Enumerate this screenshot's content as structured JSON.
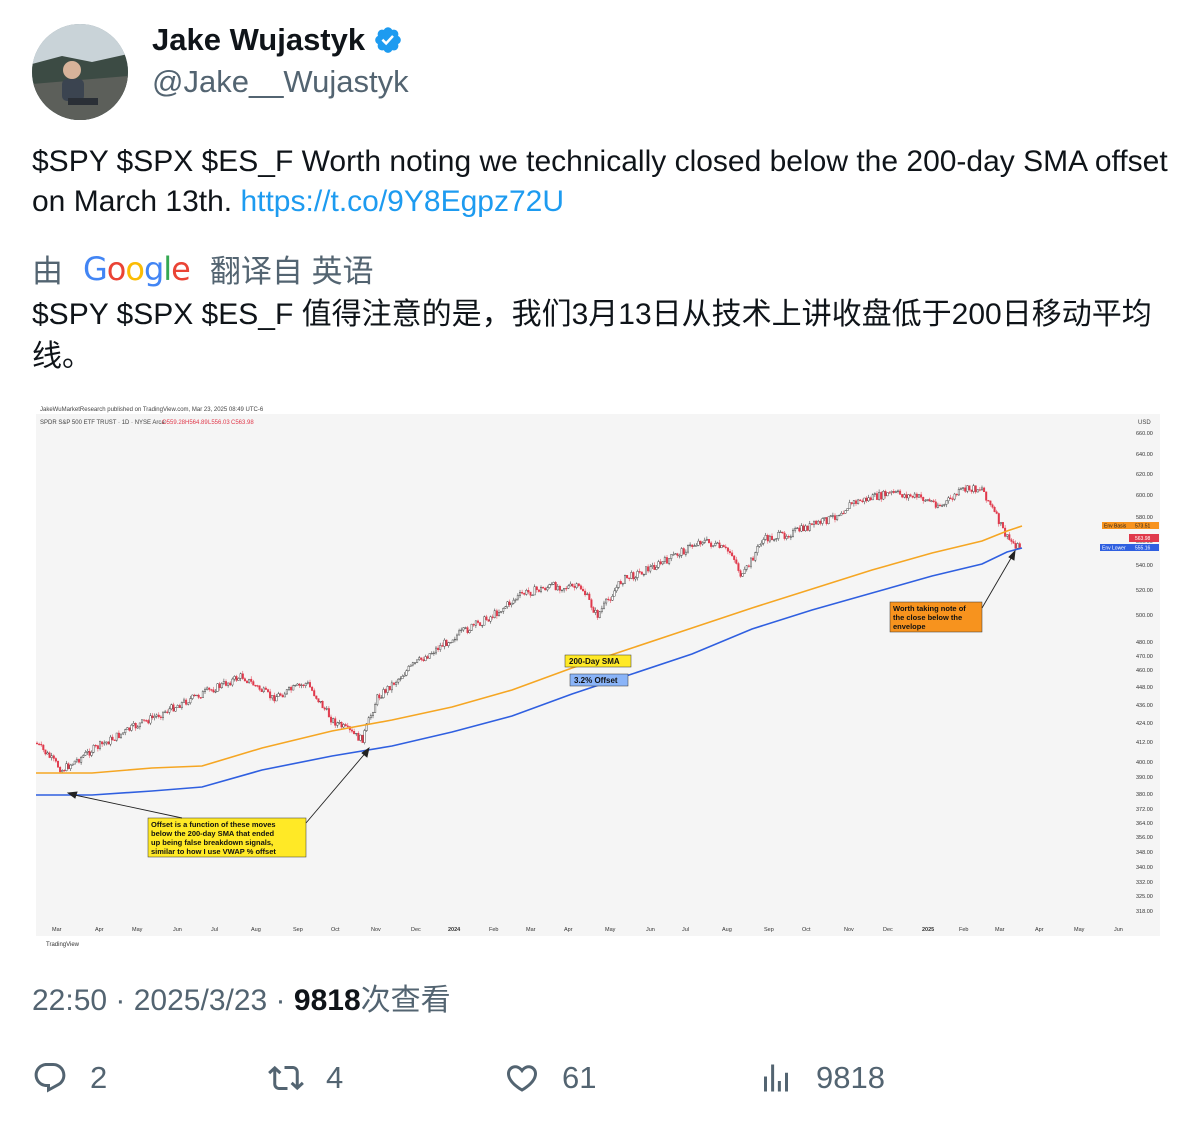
{
  "author": {
    "name": "Jake Wujastyk",
    "handle": "@Jake__Wujastyk",
    "verified": true
  },
  "tweet": {
    "text_prefix": "$SPY $SPX $ES_F Worth noting we technically closed below the 200-day SMA offset on March 13th. ",
    "link": "https://t.co/9Y8Egpz72U"
  },
  "translation": {
    "prefix": "由",
    "provider": "Google",
    "suffix": "翻译自 英语",
    "text": "$SPY $SPX $ES_F 值得注意的是，我们3月13日从技术上讲收盘低于200日移动平均线。"
  },
  "chart": {
    "header_published": "JakeWuMarketResearch published on TradingView.com, Mar 23, 2025 08:49 UTC-6",
    "symbol_line": "SPDR S&P 500 ETF TRUST · 1D · NYSE Arca",
    "ohlc": {
      "o": "O559.28",
      "h": "H564.89",
      "l": "L556.03",
      "c": "C563.98"
    },
    "currency": "USD",
    "y_ticks": [
      "660.00",
      "640.00",
      "620.00",
      "600.00",
      "580.00",
      "560.00",
      "540.00",
      "520.00",
      "500.00",
      "480.00",
      "470.00",
      "460.00",
      "448.00",
      "436.00",
      "424.00",
      "412.00",
      "400.00",
      "390.00",
      "380.00",
      "372.00",
      "364.00",
      "356.00",
      "348.00",
      "340.00",
      "332.00",
      "325.00",
      "318.00"
    ],
    "x_ticks": [
      "Mar",
      "Apr",
      "May",
      "Jun",
      "Jul",
      "Aug",
      "Sep",
      "Oct",
      "Nov",
      "Dec",
      "2024",
      "Feb",
      "Mar",
      "Apr",
      "May",
      "Jun",
      "Jul",
      "Aug",
      "Sep",
      "Oct",
      "Nov",
      "Dec",
      "2025",
      "Feb",
      "Mar",
      "Apr",
      "May",
      "Jun"
    ],
    "price_labels": {
      "env_basis_label": "Env Basis",
      "env_basis_value": "573.51",
      "close_value": "563.98",
      "env_lower_label": "Env Lower",
      "env_lower_value": "555.16"
    },
    "annotations": {
      "sma_label": "200-Day SMA",
      "offset_label": "3.2% Offset",
      "note_right": [
        "Worth taking note of",
        "the close below the",
        "envelope"
      ],
      "note_left": [
        "Offset is a function of these moves",
        "below the 200-day SMA that ended",
        "up being false breakdown signals,",
        "similar to how I use VWAP % offset"
      ]
    },
    "footer_brand": "TradingView",
    "colors": {
      "sma": "#f5a623",
      "offset": "#2f5fe0",
      "up": "#2b2b2b",
      "down": "#e0394b",
      "note_orange": "#f7931e",
      "note_yellow": "#ffe926"
    }
  },
  "meta": {
    "time": "22:50",
    "date": "2025/3/23",
    "views": "9818",
    "views_suffix": "次查看"
  },
  "actions": {
    "replies": "2",
    "reposts": "4",
    "likes": "61",
    "views": "9818"
  }
}
